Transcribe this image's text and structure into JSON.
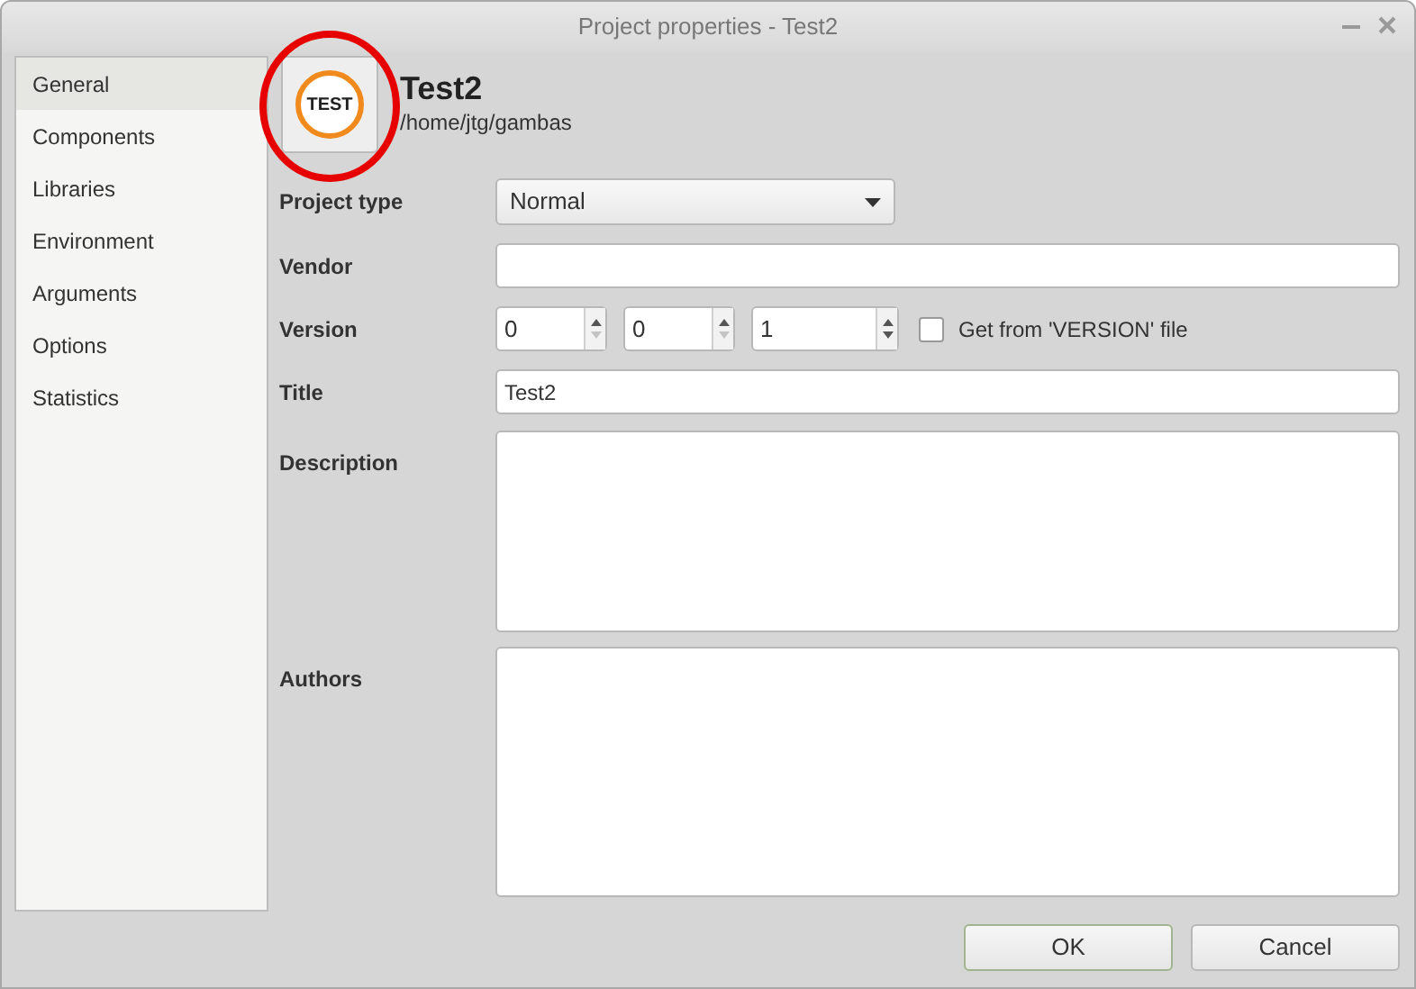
{
  "window": {
    "title": "Project properties - Test2"
  },
  "sidebar": {
    "items": [
      {
        "label": "General",
        "selected": true
      },
      {
        "label": "Components",
        "selected": false
      },
      {
        "label": "Libraries",
        "selected": false
      },
      {
        "label": "Environment",
        "selected": false
      },
      {
        "label": "Arguments",
        "selected": false
      },
      {
        "label": "Options",
        "selected": false
      },
      {
        "label": "Statistics",
        "selected": false
      }
    ]
  },
  "project": {
    "icon_text": "TEST",
    "name": "Test2",
    "path": "/home/jtg/gambas"
  },
  "form": {
    "project_type": {
      "label": "Project type",
      "value": "Normal"
    },
    "vendor": {
      "label": "Vendor"
    },
    "version": {
      "label": "Version",
      "parts": [
        {
          "value": "0",
          "down_enabled": false
        },
        {
          "value": "0",
          "down_enabled": false
        },
        {
          "value": "1",
          "down_enabled": true
        }
      ],
      "from_file": {
        "label": "Get from 'VERSION' file",
        "checked": false
      }
    },
    "title": {
      "label": "Title",
      "value": "Test2"
    },
    "description": {
      "label": "Description"
    },
    "authors": {
      "label": "Authors"
    }
  },
  "buttons": [
    {
      "label": "OK",
      "default": true
    },
    {
      "label": "Cancel",
      "default": false
    }
  ]
}
